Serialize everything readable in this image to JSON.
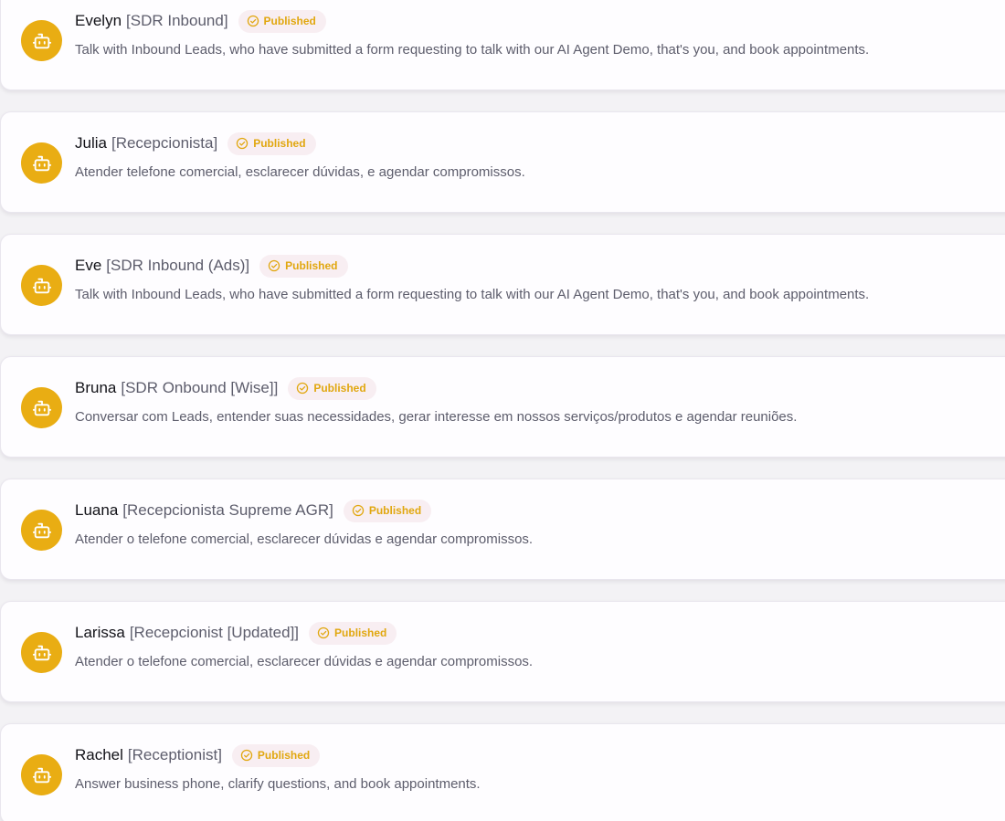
{
  "status_color": "#e1a70f",
  "avatar_color": "#e9ad13",
  "agents": [
    {
      "name": "Evelyn",
      "role": "[SDR Inbound]",
      "status": "Published",
      "status_icon": "check-circle-icon",
      "avatar_icon": "bot-icon",
      "description": "Talk with Inbound Leads, who have submitted a form requesting to talk with our AI Agent Demo, that's you, and book appointments."
    },
    {
      "name": "Julia",
      "role": "[Recepcionista]",
      "status": "Published",
      "status_icon": "check-circle-icon",
      "avatar_icon": "bot-icon",
      "description": "Atender telefone comercial, esclarecer dúvidas, e agendar compromissos."
    },
    {
      "name": "Eve",
      "role": "[SDR Inbound (Ads)]",
      "status": "Published",
      "status_icon": "check-circle-icon",
      "avatar_icon": "bot-icon",
      "description": "Talk with Inbound Leads, who have submitted a form requesting to talk with our AI Agent Demo, that's you, and book appointments."
    },
    {
      "name": "Bruna",
      "role": "[SDR Onbound [Wise]]",
      "status": "Published",
      "status_icon": "check-circle-icon",
      "avatar_icon": "bot-icon",
      "description": "Conversar com Leads, entender suas necessidades, gerar interesse em nossos serviços/produtos e agendar reuniões."
    },
    {
      "name": "Luana",
      "role": "[Recepcionista Supreme AGR]",
      "status": "Published",
      "status_icon": "check-circle-icon",
      "avatar_icon": "bot-icon",
      "description": "Atender o telefone comercial, esclarecer dúvidas e agendar compromissos."
    },
    {
      "name": "Larissa",
      "role": "[Recepcionist [Updated]]",
      "status": "Published",
      "status_icon": "check-circle-icon",
      "avatar_icon": "bot-icon",
      "description": "Atender o telefone comercial, esclarecer dúvidas e agendar compromissos."
    },
    {
      "name": "Rachel",
      "role": "[Receptionist]",
      "status": "Published",
      "status_icon": "check-circle-icon",
      "avatar_icon": "bot-icon",
      "description": "Answer business phone, clarify questions, and book appointments."
    }
  ]
}
